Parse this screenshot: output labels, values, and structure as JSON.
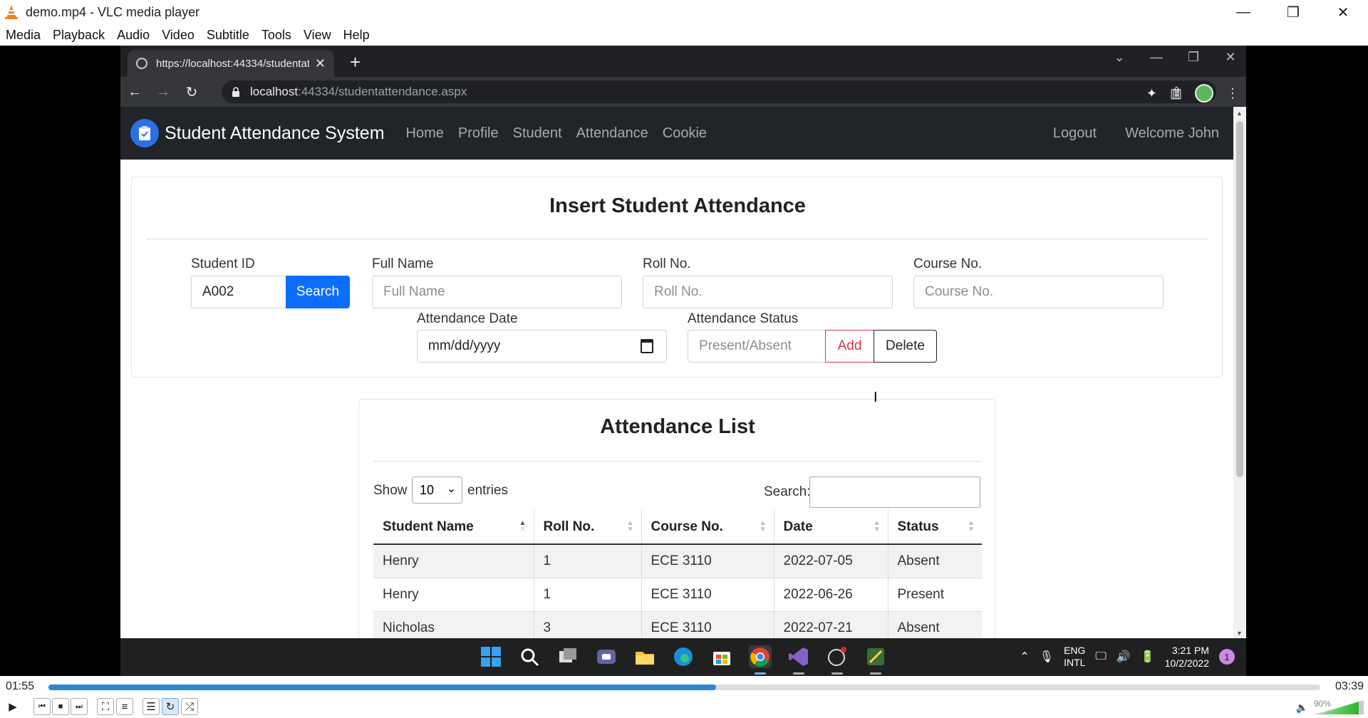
{
  "vlc": {
    "title": "demo.mp4 - VLC media player",
    "menu": [
      "Media",
      "Playback",
      "Audio",
      "Video",
      "Subtitle",
      "Tools",
      "View",
      "Help"
    ],
    "time_elapsed": "01:55",
    "time_total": "03:39",
    "progress_fraction": 0.525,
    "volume": "90%"
  },
  "browser": {
    "tab_title": "https://localhost:44334/studentat",
    "url_host": "localhost",
    "url_path": ":44334/studentattendance.aspx"
  },
  "site": {
    "brand": "Student Attendance System",
    "nav": [
      "Home",
      "Profile",
      "Student",
      "Attendance",
      "Cookie"
    ],
    "logout": "Logout",
    "welcome": "Welcome John"
  },
  "form": {
    "title": "Insert Student Attendance",
    "student_id_label": "Student ID",
    "student_id_value": "A002",
    "search_button": "Search",
    "full_name_label": "Full Name",
    "full_name_placeholder": "Full Name",
    "roll_label": "Roll No.",
    "roll_placeholder": "Roll No.",
    "course_label": "Course No.",
    "course_placeholder": "Course No.",
    "date_label": "Attendance Date",
    "date_placeholder": "mm/dd/yyyy",
    "status_label": "Attendance Status",
    "status_placeholder": "Present/Absent",
    "add_button": "Add",
    "delete_button": "Delete"
  },
  "list": {
    "title": "Attendance List",
    "show_label": "Show",
    "entries_value": "10",
    "entries_label": "entries",
    "search_label": "Search:",
    "headers": [
      "Student Name",
      "Roll No.",
      "Course No.",
      "Date",
      "Status"
    ],
    "rows": [
      [
        "Henry",
        "1",
        "ECE 3110",
        "2022-07-05",
        "Absent"
      ],
      [
        "Henry",
        "1",
        "ECE 3110",
        "2022-06-26",
        "Present"
      ],
      [
        "Nicholas",
        "3",
        "ECE 3110",
        "2022-07-21",
        "Absent"
      ]
    ]
  },
  "taskbar": {
    "lang_1": "ENG",
    "lang_2": "INTL",
    "time": "3:21 PM",
    "date": "10/2/2022",
    "notifications": "1"
  }
}
